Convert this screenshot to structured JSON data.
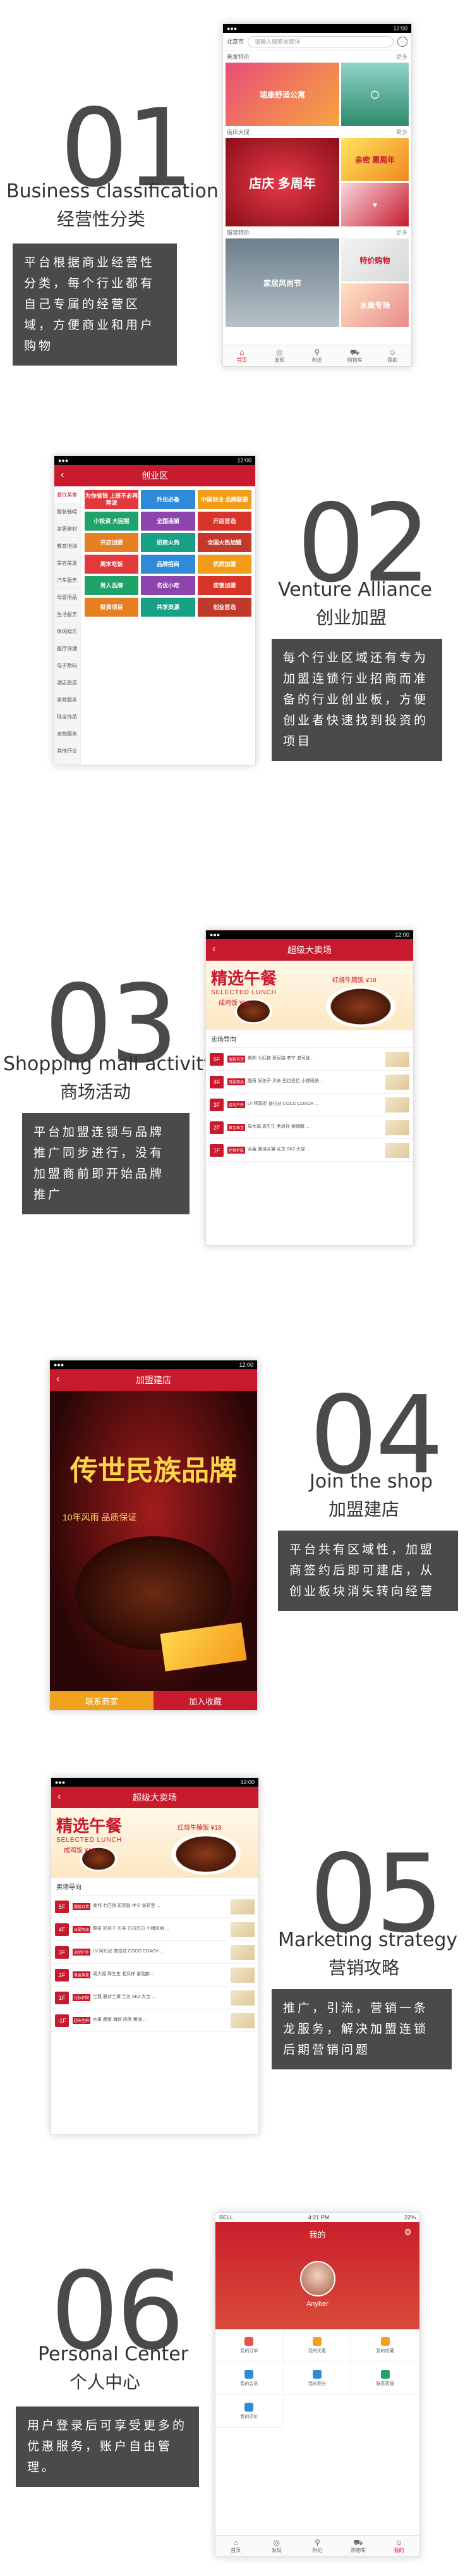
{
  "sections": [
    {
      "num": "01",
      "en": "Business classification",
      "cn": "经营性分类",
      "desc": "平台根据商业经营性分类，每个行业都有自己专属的经营区域，方便商业和用户购物"
    },
    {
      "num": "02",
      "en": "Venture Alliance",
      "cn": "创业加盟",
      "desc": "每个行业区域还有专为加盟连锁行业招商而准备的行业创业板，方便创业者快速找到投资的项目"
    },
    {
      "num": "03",
      "en": "Shopping mall activity",
      "cn": "商场活动",
      "desc": "平台加盟连锁与品牌推广同步进行，没有加盟商前即开始品牌推广"
    },
    {
      "num": "04",
      "en": "Join the shop",
      "cn": "加盟建店",
      "desc": "平台共有区域性，加盟商签约后即可建店，从创业板块消失转向经营"
    },
    {
      "num": "05",
      "en": "Marketing strategy",
      "cn": "营销攻略",
      "desc": "推广，引流，营销一条龙服务，解决加盟连锁后期营销问题"
    },
    {
      "num": "06",
      "en": "Personal Center",
      "cn": "个人中心",
      "desc": "用户登录后可享受更多的优惠服务，账户自由管理。"
    }
  ],
  "phone1": {
    "city": "北京市",
    "search_placeholder": "请输入搜索关键词",
    "cats": [
      {
        "name": "美发特价",
        "more": "更多"
      },
      {
        "name": "店庆大促",
        "more": "更多"
      },
      {
        "name": "服装特价",
        "more": "更多"
      }
    ],
    "ads": [
      "瑞康舒适公寓",
      "店庆 多周年",
      "亲密 惠周年",
      "家居风尚节",
      "特价购物",
      "水果专场"
    ],
    "tabs": [
      "首页",
      "发现",
      "附近",
      "购物车",
      "我的"
    ]
  },
  "phone2": {
    "title": "创业区",
    "side": [
      "餐饮美食",
      "服装鞋帽",
      "家居建材",
      "教育培训",
      "美容美发",
      "汽车服务",
      "母婴用品",
      "生活服务",
      "休闲娱乐",
      "医疗保健",
      "电子数码",
      "酒店旅游",
      "家政服务",
      "珠宝饰品",
      "宠物服务",
      "其他行业"
    ],
    "cells": [
      "为你省钱 上班不必再奔波",
      "外出必备",
      "中国创业 品牌联盟",
      "小投资 大回报",
      "全国连锁",
      "开店首选",
      "开店加盟",
      "招商火热",
      "全国火热加盟",
      "周末吃饭",
      "品牌招商",
      "优质加盟",
      "男人品牌",
      "名优小吃",
      "连锁加盟",
      "投资项目",
      "共享资源",
      "创业首选"
    ]
  },
  "phone3": {
    "title": "超级大卖场",
    "banner_title": "精选午餐",
    "banner_sub": "SELECTED LUNCH",
    "price_a": "成鸡饭 ¥16",
    "price_b": "红烧牛腩饭 ¥18",
    "section": "卖场导向",
    "rows": [
      {
        "floor": "5F",
        "tag": "服装百货",
        "text": "美邦 七匹狼 班尼路 李宁 波司登 ..."
      },
      {
        "floor": "4F",
        "tag": "母婴用品",
        "text": "酷奇 好孩子 贝亲 巴拉巴拉 小猪班纳 ..."
      },
      {
        "floor": "3F",
        "tag": "运动户外",
        "text": "LV 阿玛尼 普拉达 COCO COACH ..."
      },
      {
        "floor": "2F",
        "tag": "黄金珠宝",
        "text": "周大福 周生生 老凤祥 谢瑞麟 ..."
      },
      {
        "floor": "1F",
        "tag": "化妆护肤",
        "text": "兰蔻 雅诗兰黛 兰芝 SK2 大宝 ..."
      }
    ]
  },
  "phone4": {
    "title": "加盟建店",
    "poster_title": "传世民族品牌",
    "poster_sub": "10年风雨 品质保证",
    "contact": "联系商家",
    "favorite": "加入收藏"
  },
  "phone5": {
    "title": "超级大卖场",
    "banner_title": "精选午餐",
    "banner_sub": "SELECTED LUNCH",
    "price_a": "成鸡饭 ¥16",
    "price_b": "红烧牛腩饭 ¥18",
    "section": "卖场导向",
    "rows": [
      {
        "floor": "5F",
        "tag": "服装百货",
        "text": "美邦 七匹狼 班尼路 李宁 波司登 ..."
      },
      {
        "floor": "4F",
        "tag": "母婴用品",
        "text": "酷奇 好孩子 贝亲 巴拉巴拉 小猪班纳 ..."
      },
      {
        "floor": "3F",
        "tag": "运动户外",
        "text": "LV 阿玛尼 普拉达 COCO COACH ..."
      },
      {
        "floor": "2F",
        "tag": "黄金珠宝",
        "text": "周大福 周生生 老凤祥 谢瑞麟 ..."
      },
      {
        "floor": "1F",
        "tag": "化妆护肤",
        "text": "兰蔻 雅诗兰黛 兰芝 SK2 大宝 ..."
      },
      {
        "floor": "-1F",
        "tag": "超市生鲜",
        "text": "水果 蔬菜 海鲜 肉类 粮油 ..."
      }
    ]
  },
  "phone6": {
    "carrier": "BELL",
    "time": "4:21 PM",
    "battery": "22%",
    "title": "我的",
    "username": "Anyber",
    "cells": [
      "我的订单",
      "我的优惠",
      "我的收藏",
      "我的会员",
      "我的积分",
      "联系客服",
      "我的评价"
    ],
    "tabs": [
      "首页",
      "发现",
      "附近",
      "购物车",
      "我的"
    ]
  },
  "colors": {
    "brand_red": "#c81a2d",
    "dark_gray": "#4a4a4a"
  }
}
